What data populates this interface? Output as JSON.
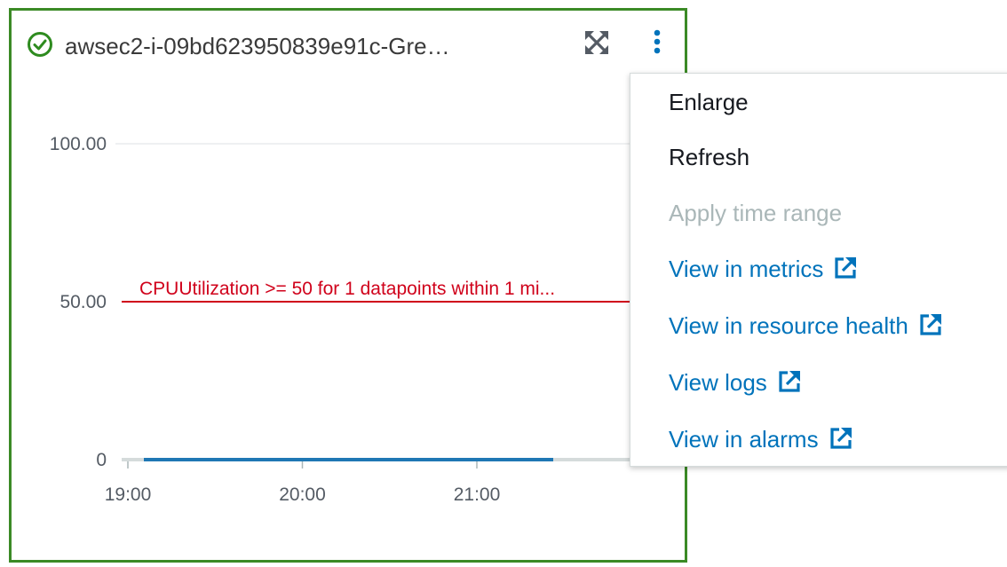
{
  "widget": {
    "title": "awsec2-i-09bd623950839e91c-Gre…",
    "status": "ok",
    "colors": {
      "border": "#3b8a26",
      "threshold": "#d0021b",
      "series": "#1f77b4"
    }
  },
  "chart_data": {
    "type": "line",
    "x_ticks": [
      "19:00",
      "20:00",
      "21:00"
    ],
    "y_ticks": [
      "0",
      "50.00",
      "100.00"
    ],
    "ylim": [
      0,
      100
    ],
    "threshold": {
      "value": 50,
      "label": "CPUUtilization >= 50 for 1 datapoints within 1 mi..."
    },
    "series": [
      {
        "values": [
          0,
          0,
          0
        ]
      }
    ]
  },
  "menu": {
    "items": [
      {
        "label": "Enlarge",
        "state": "normal"
      },
      {
        "label": "Refresh",
        "state": "normal"
      },
      {
        "label": "Apply time range",
        "state": "disabled"
      },
      {
        "label": "View in metrics",
        "state": "link",
        "external": true
      },
      {
        "label": "View in resource health",
        "state": "link",
        "external": true
      },
      {
        "label": "View logs",
        "state": "link",
        "external": true
      },
      {
        "label": "View in alarms",
        "state": "link",
        "external": true
      }
    ]
  }
}
